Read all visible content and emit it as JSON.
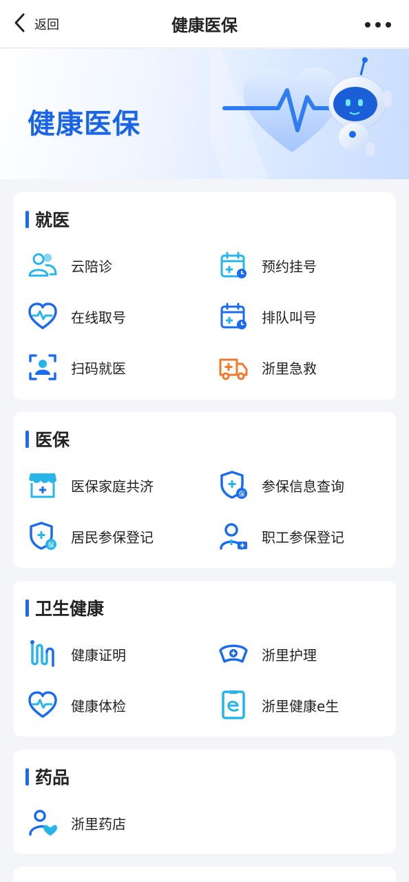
{
  "nav": {
    "back_label": "返回",
    "title": "健康医保"
  },
  "banner": {
    "title": "健康医保"
  },
  "sections": [
    {
      "title": "就医",
      "items": [
        {
          "label": "云陪诊",
          "icon": "people-icon"
        },
        {
          "label": "预约挂号",
          "icon": "calendar-plus-icon"
        },
        {
          "label": "在线取号",
          "icon": "heart-pulse-icon"
        },
        {
          "label": "排队叫号",
          "icon": "calendar-clock-icon"
        },
        {
          "label": "扫码就医",
          "icon": "scan-person-icon"
        },
        {
          "label": "浙里急救",
          "icon": "ambulance-icon"
        }
      ]
    },
    {
      "title": "医保",
      "items": [
        {
          "label": "医保家庭共济",
          "icon": "medical-store-icon"
        },
        {
          "label": "参保信息查询",
          "icon": "shield-badge-icon"
        },
        {
          "label": "居民参保登记",
          "icon": "shield-plus-icon"
        },
        {
          "label": "职工参保登记",
          "icon": "worker-icon"
        }
      ]
    },
    {
      "title": "卫生健康",
      "items": [
        {
          "label": "健康证明",
          "icon": "certificate-icon"
        },
        {
          "label": "浙里护理",
          "icon": "nurse-cap-icon"
        },
        {
          "label": "健康体检",
          "icon": "heart-check-icon"
        },
        {
          "label": "浙里健康e生",
          "icon": "e-document-icon"
        }
      ]
    },
    {
      "title": "药品",
      "items": [
        {
          "label": "浙里药店",
          "icon": "pharmacy-person-icon"
        }
      ]
    }
  ],
  "badges": {
    "bao": "保"
  },
  "colors": {
    "accent": "#1a6bf0",
    "cyan": "#27b4e8",
    "orange": "#f07a2c",
    "background": "#f3f5f8"
  }
}
